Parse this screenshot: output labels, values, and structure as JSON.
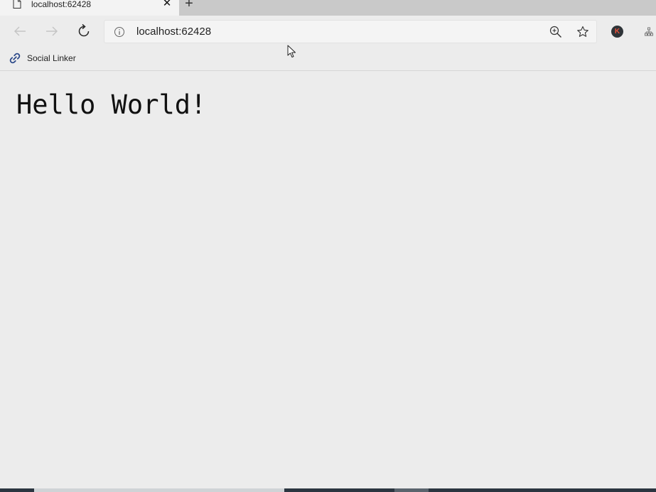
{
  "tab": {
    "title": "localhost:62428",
    "close_glyph": "✕",
    "page_icon": "page-icon"
  },
  "new_tab": {
    "glyph": "+"
  },
  "toolbar": {
    "back_icon": "back-arrow-icon",
    "forward_icon": "forward-arrow-icon",
    "refresh_icon": "refresh-icon",
    "url": "localhost:62428",
    "info_icon": "info-icon",
    "zoom_icon": "zoom-in-icon",
    "favorite_icon": "star-icon",
    "profile_initial": "K",
    "extension_icon": "extension-icon"
  },
  "favorites_bar": {
    "items": [
      {
        "label": "Social Linker",
        "icon": "link-icon"
      }
    ]
  },
  "page": {
    "heading": "Hello World!"
  },
  "colors": {
    "tab_strip": "#c9c9c9",
    "active_tab": "#f3f3f3",
    "chrome": "#ececec",
    "address_bar": "#f4f4f4",
    "link_icon": "#2d4a8a",
    "avatar_bg": "#2f3438",
    "avatar_letter": "#e8503a",
    "taskbar": "#2b3540"
  }
}
